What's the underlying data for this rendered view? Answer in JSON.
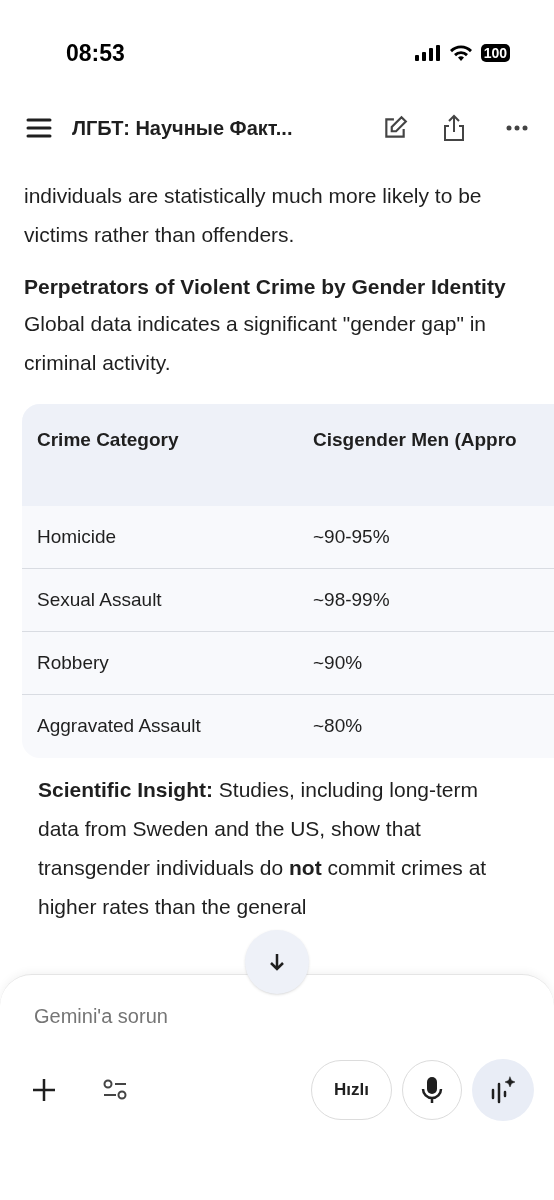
{
  "status_bar": {
    "time": "08:53",
    "battery": "100"
  },
  "header": {
    "title": "ЛГБТ: Научные Факт..."
  },
  "intro": "individuals are statistically much more likely to be victims rather than offenders.",
  "heading": "Perpetrators of Violent Crime by Gender Identity",
  "lead": "Global data indicates a significant \"gender gap\" in criminal activity.",
  "table": {
    "columns": [
      "Crime Category",
      "Cisgender Men (Appro"
    ],
    "rows": [
      [
        "Homicide",
        "~90-95%"
      ],
      [
        "Sexual Assault",
        "~98-99%"
      ],
      [
        "Robbery",
        "~90%"
      ],
      [
        "Aggravated Assault",
        "~80%"
      ]
    ]
  },
  "insight": "**Scientific Insight:** Studies, including long-term data from Sweden and the US, show that transgender individuals do **not** commit crimes at higher rates than the general",
  "composer": {
    "placeholder": "Gemini'a sorun",
    "mode_button": "Hızlı"
  }
}
